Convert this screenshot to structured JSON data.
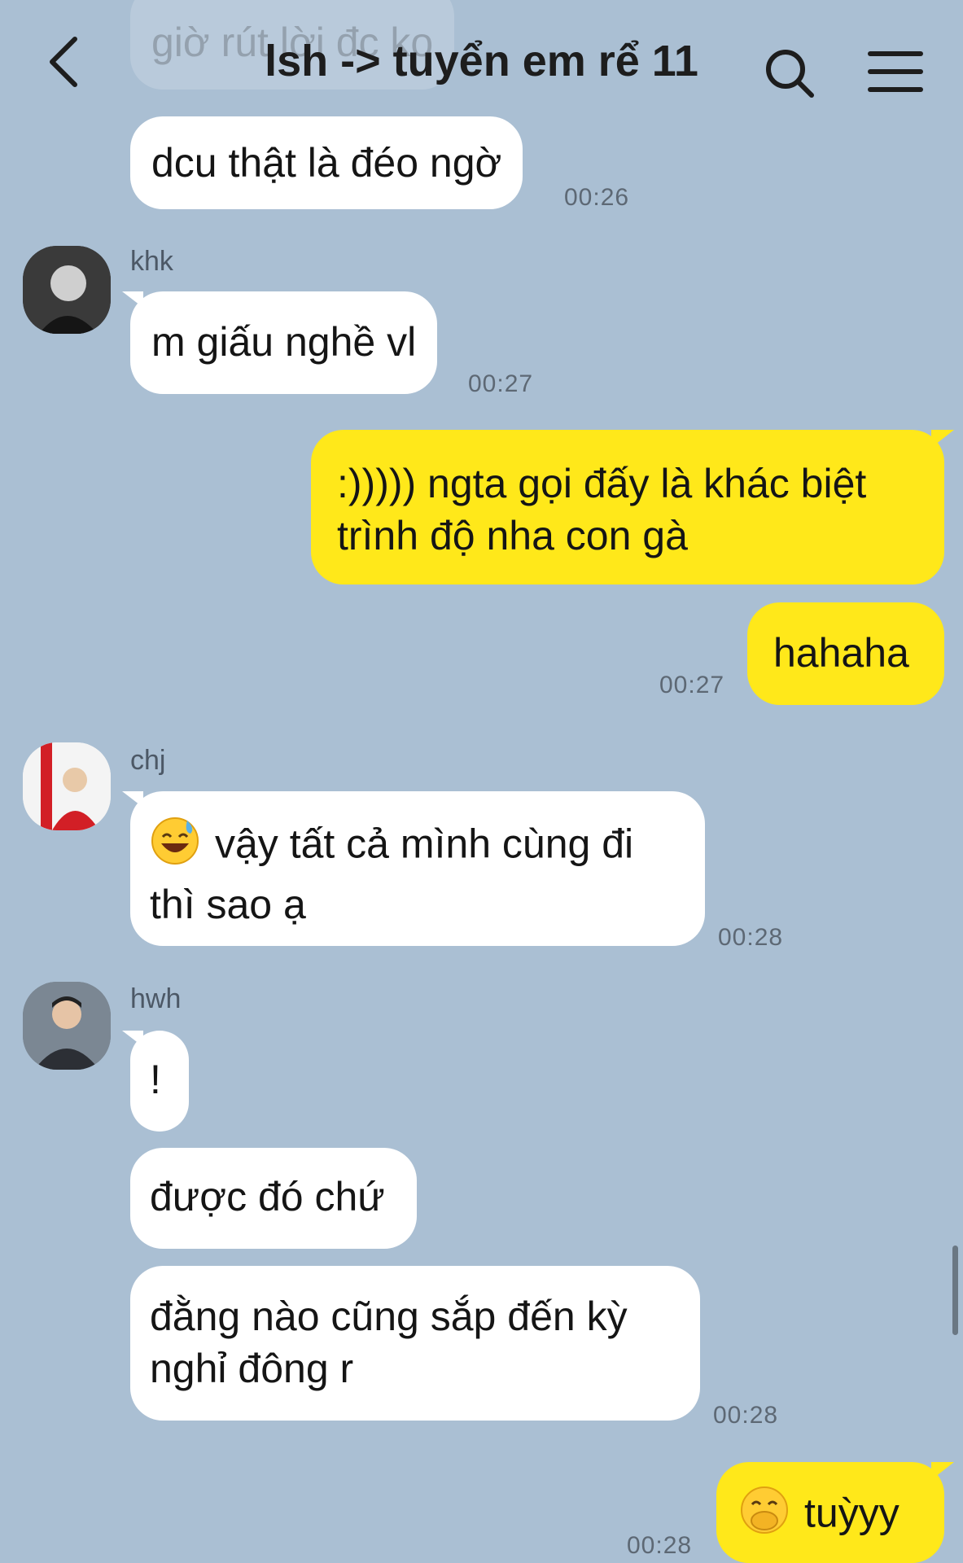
{
  "header": {
    "title": "lsh -> tuyển em rể 11",
    "icons": {
      "back": "back-chevron-icon",
      "search": "search-icon",
      "menu": "menu-icon"
    }
  },
  "colors": {
    "background": "#aabfd3",
    "incoming": "#ffffff",
    "outgoing": "#ffe81a"
  },
  "faded_top_message": "giờ rút lời đc ko",
  "messages": [
    {
      "sender": "",
      "text": "dcu thật là đéo ngờ",
      "time": "00:26"
    },
    {
      "sender": "khk",
      "text": "m giấu nghề vl",
      "time": "00:27"
    },
    {
      "sender": "me",
      "text_lines": [
        ":))))) ngta gọi đấy là khác biệt",
        "trình độ nha con gà"
      ]
    },
    {
      "sender": "me",
      "text": "hahaha",
      "time": "00:27"
    },
    {
      "sender": "chj",
      "emoji": "sweat-smile-emoji",
      "text_lines": [
        "vậy tất cả mình cùng đi",
        "thì sao ạ"
      ],
      "time": "00:28"
    },
    {
      "sender": "hwh",
      "text": "!"
    },
    {
      "sender": "hwh",
      "text": "được đó chứ"
    },
    {
      "sender": "hwh",
      "text_lines": [
        "đằng nào cũng sắp đến kỳ",
        "nghỉ đông r"
      ],
      "time": "00:28"
    },
    {
      "sender": "me",
      "emoji": "hand-over-mouth-emoji",
      "text": "tuỳyy",
      "time": "00:28"
    }
  ]
}
